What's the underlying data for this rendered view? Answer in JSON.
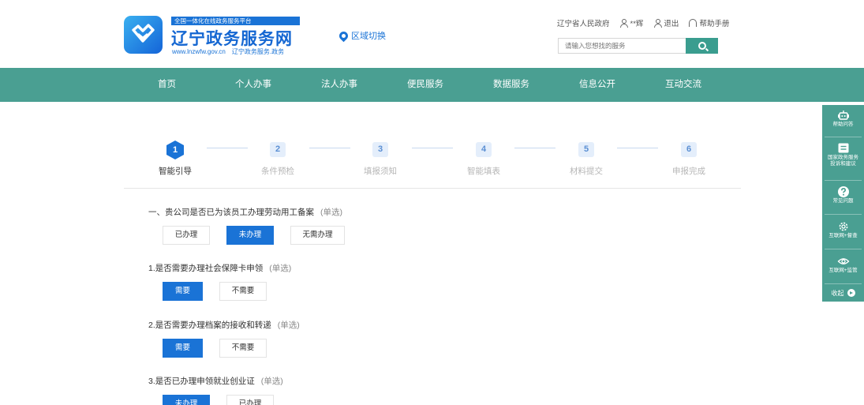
{
  "header": {
    "tagline": "全国一体化在线政务服务平台",
    "site_title": "辽宁政务服务网",
    "site_url": "www.lnzwfw.gov.cn",
    "site_subtitle": "辽宁政务服务.政务",
    "region_switch": "区域切换",
    "links": {
      "gov": "辽宁省人民政府",
      "user": "**辉",
      "logout": "退出",
      "help": "帮助手册"
    },
    "search_placeholder": "请输入您想找的服务"
  },
  "nav": [
    "首页",
    "个人办事",
    "法人办事",
    "便民服务",
    "数据服务",
    "信息公开",
    "互动交流"
  ],
  "steps": [
    {
      "num": "1",
      "label": "智能引导",
      "active": true
    },
    {
      "num": "2",
      "label": "条件预检",
      "active": false
    },
    {
      "num": "3",
      "label": "填报须知",
      "active": false
    },
    {
      "num": "4",
      "label": "智能填表",
      "active": false
    },
    {
      "num": "5",
      "label": "材料提交",
      "active": false
    },
    {
      "num": "6",
      "label": "申报完成",
      "active": false
    }
  ],
  "questions": [
    {
      "title": "一、贵公司是否已为该员工办理劳动用工备案",
      "type": "(单选)",
      "options": [
        "已办理",
        "未办理",
        "无需办理"
      ],
      "selected": 1
    },
    {
      "title": "1.是否需要办理社会保障卡申领",
      "type": "(单选)",
      "options": [
        "需要",
        "不需要"
      ],
      "selected": 0
    },
    {
      "title": "2.是否需要办理档案的接收和转递",
      "type": "(单选)",
      "options": [
        "需要",
        "不需要"
      ],
      "selected": 0
    },
    {
      "title": "3.是否已办理申领就业创业证",
      "type": "(单选)",
      "options": [
        "未办理",
        "已办理"
      ],
      "selected": 0
    }
  ],
  "sidebar": {
    "items": [
      {
        "icon": "robot-icon",
        "label": "帮助问答"
      },
      {
        "icon": "message-icon",
        "label": "国家政务服务\n投诉和建议"
      },
      {
        "icon": "question-icon",
        "label": "常见问题"
      },
      {
        "icon": "gear-icon",
        "label": "互联网+督查"
      },
      {
        "icon": "eye-icon",
        "label": "互联网+监管"
      }
    ],
    "collapse": "收起"
  },
  "colors": {
    "accent": "#1a73d6",
    "teal": "#4a9f92"
  }
}
